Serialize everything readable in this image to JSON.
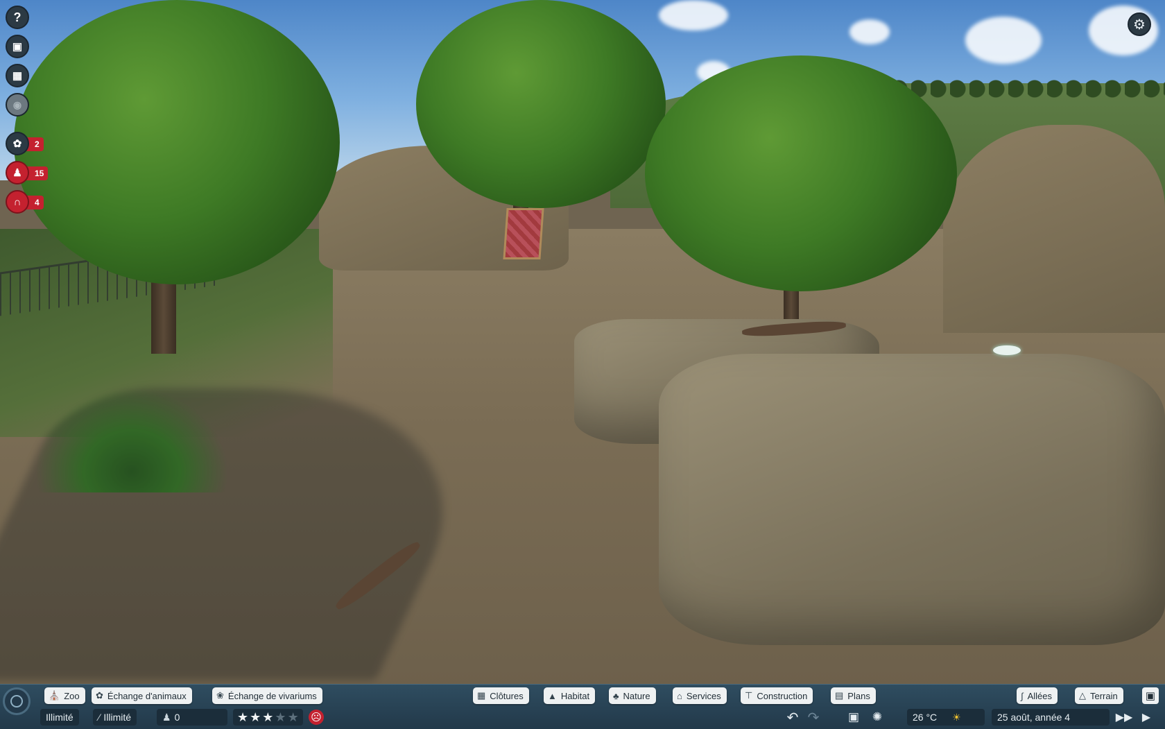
{
  "left_toolbar": {
    "help_icon": "question-icon",
    "animals_count": "2",
    "guests_count": "15",
    "staff_count": "4"
  },
  "bottom_bar": {
    "row1_left": [
      {
        "label": "Zoo",
        "icon": "zoo-icon"
      },
      {
        "label": "Échange d'animaux",
        "icon": "paw-icon"
      },
      {
        "label": "Échange de vivariums",
        "icon": "bug-icon"
      }
    ],
    "row1_center": [
      {
        "label": "Clôtures",
        "icon": "fence-icon"
      },
      {
        "label": "Habitat",
        "icon": "habitat-icon"
      },
      {
        "label": "Nature",
        "icon": "tree-icon"
      },
      {
        "label": "Services",
        "icon": "shop-icon"
      },
      {
        "label": "Construction",
        "icon": "pillar-icon"
      },
      {
        "label": "Plans",
        "icon": "blueprint-icon"
      }
    ],
    "row1_right": [
      {
        "label": "Allées",
        "icon": "path-icon"
      },
      {
        "label": "Terrain",
        "icon": "terrain-icon"
      }
    ],
    "money": "Illimité",
    "research": "Illimité",
    "guests_value": "0",
    "rating_stars": 3,
    "rating_max": 5,
    "temperature": "26 °C",
    "date": "25 août, année 4"
  },
  "colors": {
    "accent_red": "#c4212f",
    "bar_blue": "#2f4d60",
    "pill_bg": "#eef1f2"
  }
}
